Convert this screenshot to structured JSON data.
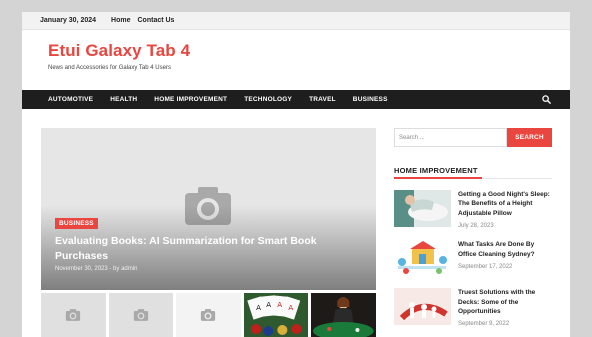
{
  "topbar": {
    "date": "January 30, 2024",
    "links": [
      "Home",
      "Contact Us"
    ]
  },
  "site": {
    "title": "Etui Galaxy Tab 4",
    "description": "News and Accessories for Galaxy Tab 4 Users"
  },
  "nav": {
    "items": [
      "AUTOMOTIVE",
      "HEALTH",
      "HOME IMPROVEMENT",
      "TECHNOLOGY",
      "TRAVEL",
      "BUSINESS"
    ],
    "search_icon": "search-icon"
  },
  "featured": {
    "category": "BUSINESS",
    "title": "Evaluating Books: AI Summarization for Smart Book Purchases",
    "date": "November 30, 2023",
    "separator": "-",
    "by": "by",
    "author": "admin",
    "placeholder_icon": "camera-icon"
  },
  "thumbnails": [
    {
      "icon": "camera-icon"
    },
    {
      "icon": "camera-icon"
    },
    {
      "icon": "camera-icon"
    },
    {
      "icon": "playing-cards-image"
    },
    {
      "icon": "casino-dealer-image"
    }
  ],
  "sidebar": {
    "search": {
      "placeholder": "Search ...",
      "button": "SEARCH"
    },
    "widget_title": "HOME IMPROVEMENT",
    "posts": [
      {
        "title": "Getting a Good Night's Sleep: The Benefits of a Height Adjustable Pillow",
        "date": "July 28, 2023"
      },
      {
        "title": "What Tasks Are Done By Office Cleaning Sydney?",
        "date": "September 17, 2022"
      },
      {
        "title": "Truest Solutions with the Decks: Some of the Opportunities",
        "date": "September 9, 2022"
      }
    ]
  },
  "colors": {
    "accent": "#e8463f",
    "nav_bg": "#1e1e1e",
    "page_bg": "#d4d4d4"
  }
}
